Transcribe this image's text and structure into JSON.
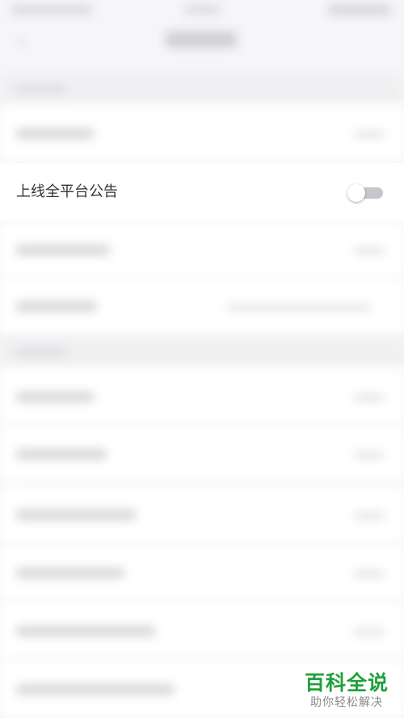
{
  "focused_setting": {
    "label": "上线全平台公告",
    "toggle_on": false
  },
  "watermark": {
    "title": "百科全说",
    "subtitle": "助你轻松解决"
  },
  "colors": {
    "background": "#f6f6f8",
    "toggle_off_track": "#c6c6cc",
    "watermark_green": "#1fa03a"
  },
  "icons": {
    "back": "chevron-left-icon"
  }
}
